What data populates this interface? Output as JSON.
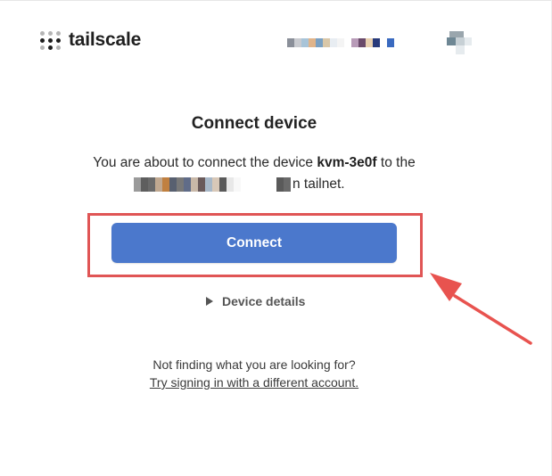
{
  "header": {
    "logo_text": "tailscale",
    "logo_icon": "tailscale-dots-icon",
    "account_pixel_colors": [
      "#8a8f99",
      "#c9cbd0",
      "#a8c4d8",
      "#e0b48a",
      "#7aa0c2",
      "#d9c7a8",
      "#e8edf2",
      "#f4f4f4",
      "#ffffff",
      "#b89bb8",
      "#6a4a6a",
      "#e8d0b0",
      "#283a7a",
      "#ffffff",
      "#3a6ac0"
    ],
    "avatar_icon": "avatar-icon",
    "avatar_colors": [
      "#9aa6ad",
      "#6e8794",
      "#c7d0d5",
      "#e6ebee"
    ]
  },
  "main": {
    "title": "Connect device",
    "desc_prefix": "You are about to connect the device",
    "device_name": "kvm-3e0f",
    "desc_suffix": "to the",
    "tailnet_label": "n tailnet.",
    "tailnet_pixel_colors": [
      "#9a9a9a",
      "#5e5e5e",
      "#6a6a6a",
      "#c0a890",
      "#c08040",
      "#586070",
      "#787878",
      "#606c88",
      "#c8b8a8",
      "#6a5a5a",
      "#a8b8c8",
      "#d8c8b8",
      "#5a5a5a",
      "#e8e8e8",
      "#f8f8f8",
      "#ffffff",
      "#ffffff",
      "#ffffff",
      "#ffffff",
      "#ffffff",
      "#5a5a5a",
      "#6a6a6a"
    ],
    "connect_label": "Connect",
    "details_label": "Device details",
    "help_text": "Not finding what you are looking for?",
    "help_link": "Try signing in with a different account."
  },
  "annotation": {
    "highlight_color": "#e05555",
    "arrow_color": "#e8534f"
  }
}
